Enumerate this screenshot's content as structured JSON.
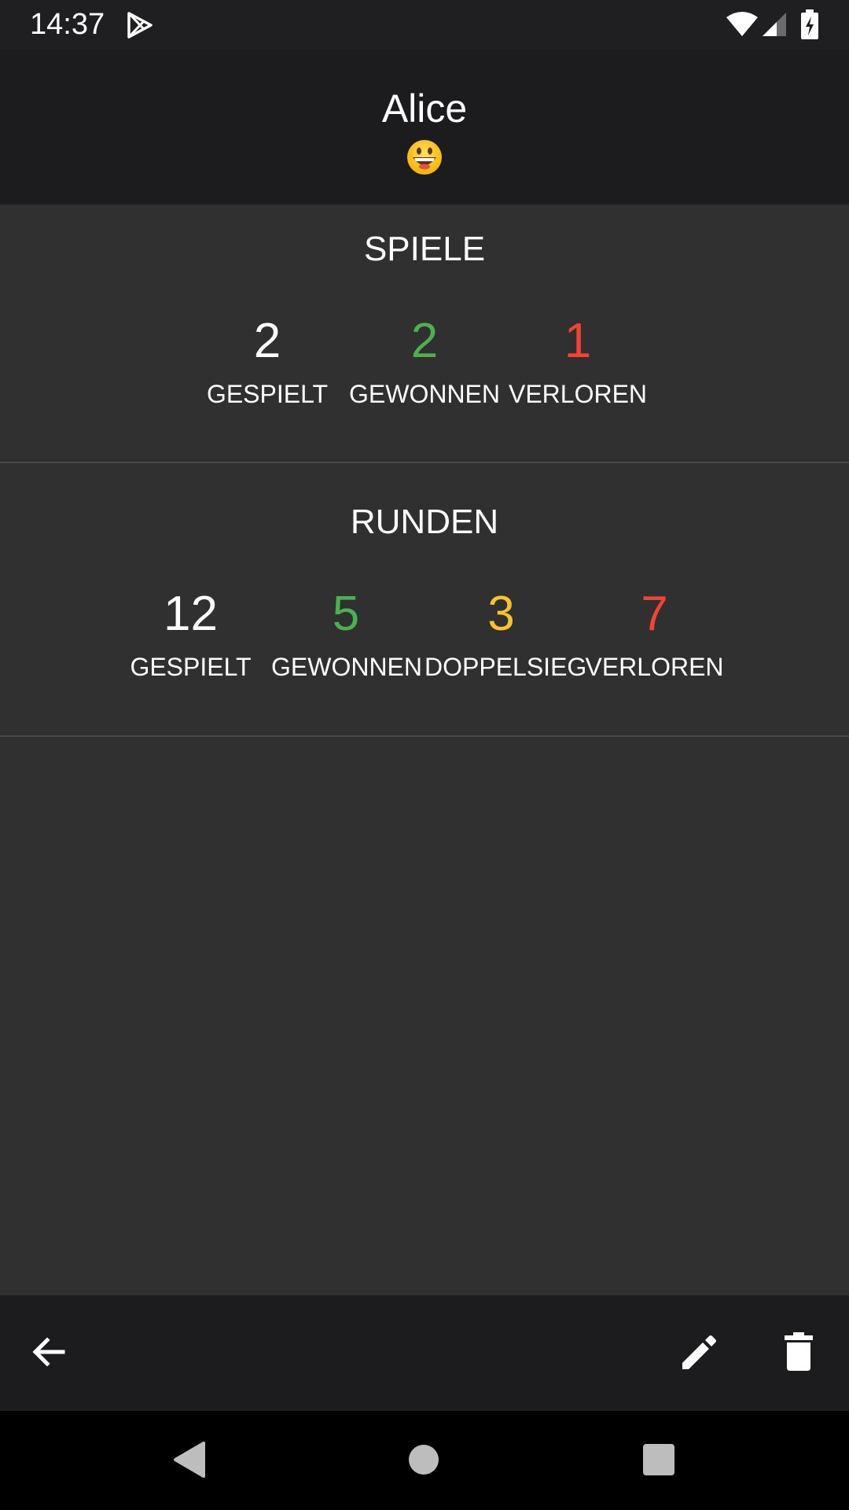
{
  "status_bar": {
    "time": "14:37",
    "icons": [
      "play-store-icon",
      "wifi-icon",
      "signal-icon",
      "battery-charging-icon"
    ]
  },
  "header": {
    "name": "Alice",
    "emoji_icon": "grinning-face-icon"
  },
  "games": {
    "title": "SPIELE",
    "stats": [
      {
        "value": "2",
        "label": "GESPIELT",
        "color": "#ffffff"
      },
      {
        "value": "2",
        "label": "GEWONNEN",
        "color": "#4caf50"
      },
      {
        "value": "1",
        "label": "VERLOREN",
        "color": "#f44336"
      }
    ]
  },
  "rounds": {
    "title": "RUNDEN",
    "stats": [
      {
        "value": "12",
        "label": "GESPIELT",
        "color": "#ffffff"
      },
      {
        "value": "5",
        "label": "GEWONNEN",
        "color": "#4caf50"
      },
      {
        "value": "3",
        "label": "DOPPELSIEG",
        "color": "#fbc02d"
      },
      {
        "value": "7",
        "label": "VERLOREN",
        "color": "#f44336"
      }
    ]
  },
  "bottom_bar": {
    "icons": [
      "back-arrow-icon",
      "edit-pencil-icon",
      "delete-trash-icon"
    ]
  },
  "nav_bar": {
    "icons": [
      "nav-back-icon",
      "nav-home-icon",
      "nav-recents-icon"
    ]
  }
}
